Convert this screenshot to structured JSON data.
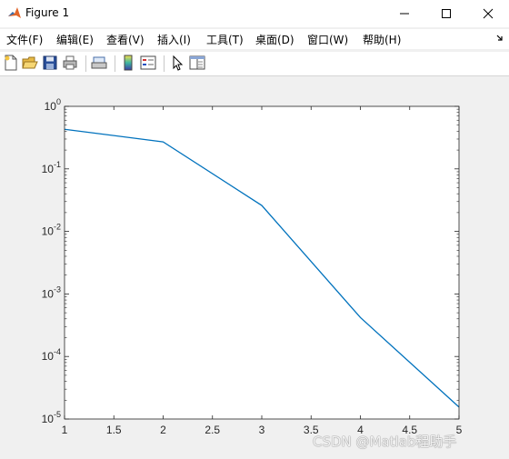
{
  "window": {
    "title": "Figure 1"
  },
  "menu": [
    {
      "label": "文件(F)"
    },
    {
      "label": "编辑(E)"
    },
    {
      "label": "查看(V)"
    },
    {
      "label": "插入(I)"
    },
    {
      "label": "工具(T)"
    },
    {
      "label": "桌面(D)"
    },
    {
      "label": "窗口(W)"
    },
    {
      "label": "帮助(H)"
    }
  ],
  "toolbar_icons": [
    "new-figure-icon",
    "open-file-icon",
    "save-icon",
    "print-icon",
    "print-preview-icon",
    "colorbar-icon",
    "legend-icon",
    "pointer-icon",
    "property-editor-icon"
  ],
  "colors": {
    "line": "#0072bd",
    "axes_bg": "#ffffff",
    "figure_bg": "#f0f0f0"
  },
  "chart_data": {
    "type": "line",
    "yscale": "log",
    "x": [
      1,
      2,
      3,
      4,
      5
    ],
    "series": [
      {
        "values": [
          0.43,
          0.27,
          0.026,
          0.00042,
          1.55e-05
        ]
      }
    ],
    "xlim": [
      1,
      5
    ],
    "ylim": [
      1e-05,
      1
    ],
    "xticks": [
      "1",
      "1.5",
      "2",
      "2.5",
      "3",
      "3.5",
      "4",
      "4.5",
      "5"
    ],
    "yticks": [
      {
        "base": "10",
        "exp": "-5"
      },
      {
        "base": "10",
        "exp": "-4"
      },
      {
        "base": "10",
        "exp": "-3"
      },
      {
        "base": "10",
        "exp": "-2"
      },
      {
        "base": "10",
        "exp": "-1"
      },
      {
        "base": "10",
        "exp": "0"
      }
    ],
    "grid": false
  },
  "watermark": "CSDN @Matlab程助手"
}
